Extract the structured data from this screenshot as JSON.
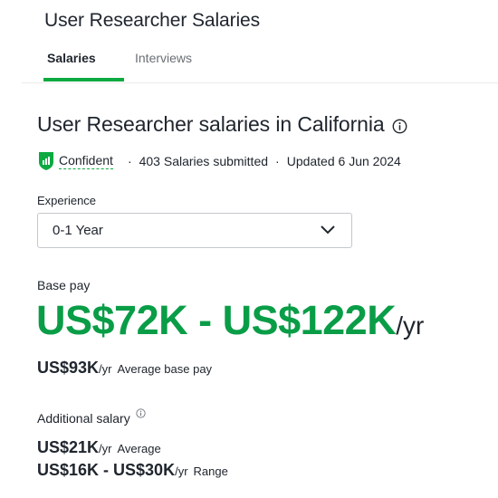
{
  "header": {
    "title": "User Researcher Salaries"
  },
  "tabs": [
    {
      "label": "Salaries",
      "active": true
    },
    {
      "label": "Interviews",
      "active": false
    }
  ],
  "main": {
    "title": "User Researcher salaries in California",
    "info_icon": "info-icon",
    "meta": {
      "confidence_icon": "shield-bars-icon",
      "confidence": "Confident",
      "separator": "·",
      "submitted": "403 Salaries submitted",
      "updated": "Updated 6 Jun 2024"
    },
    "experience": {
      "label": "Experience",
      "selected": "0-1 Year"
    },
    "base_pay": {
      "label": "Base pay",
      "range": "US$72K - US$122K",
      "unit": "/yr",
      "average_value": "US$93K",
      "average_unit": "/yr",
      "average_label": "Average base pay"
    },
    "additional": {
      "label": "Additional salary",
      "average_value": "US$21K",
      "average_unit": "/yr",
      "average_label": "Average",
      "range_value": "US$16K - US$30K",
      "range_unit": "/yr",
      "range_label": "Range"
    }
  },
  "colors": {
    "accent_green": "#0caa41",
    "range_green": "#0a9d47",
    "text": "#20262e",
    "muted": "#6b6f75"
  }
}
